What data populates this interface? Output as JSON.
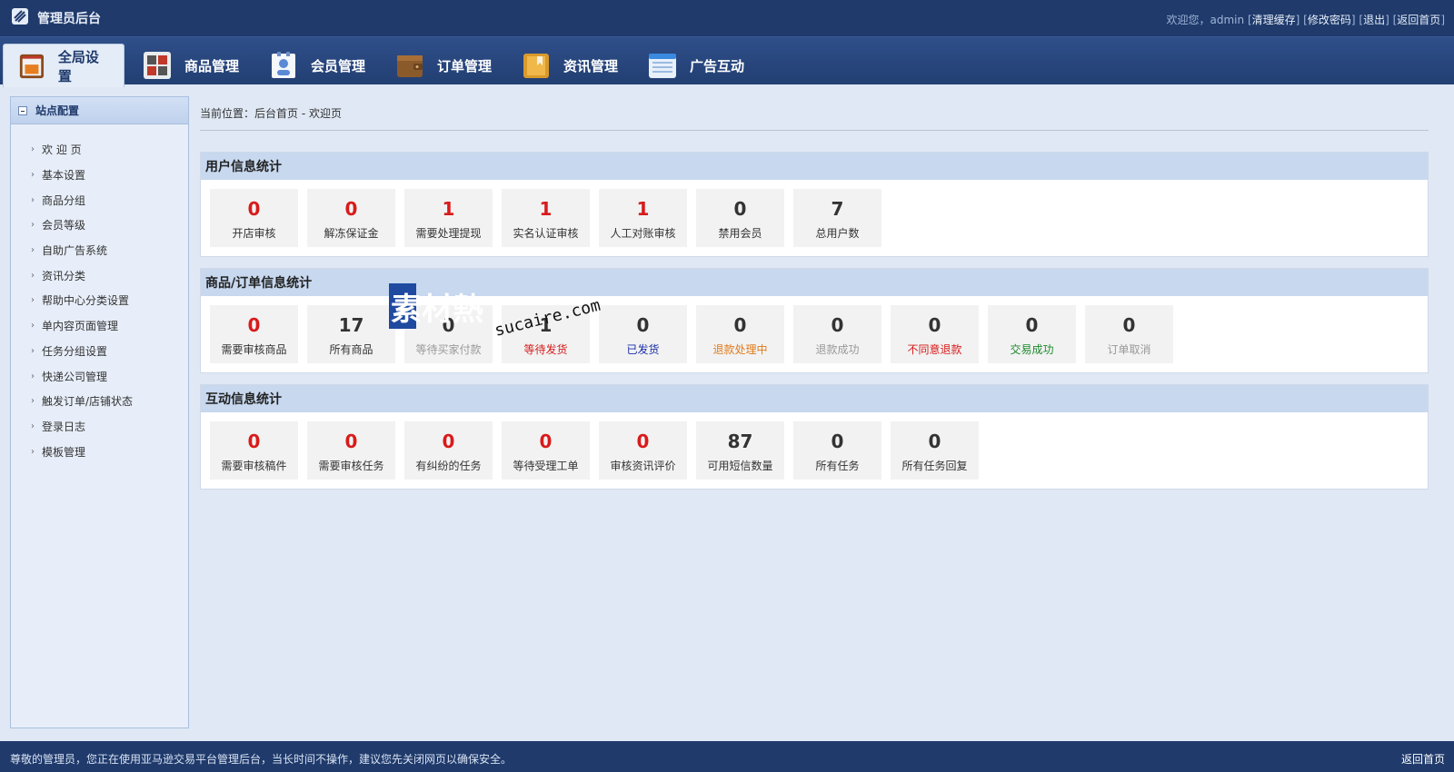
{
  "header": {
    "title": "管理员后台",
    "welcome": "欢迎您，admin",
    "links": [
      "清理缓存",
      "修改密码",
      "退出",
      "返回首页"
    ]
  },
  "nav": {
    "tabs": [
      {
        "label": "全局设置",
        "icon": "home-panel-icon",
        "active": true
      },
      {
        "label": "商品管理",
        "icon": "goods-grid-icon",
        "active": false
      },
      {
        "label": "会员管理",
        "icon": "member-card-icon",
        "active": false
      },
      {
        "label": "订单管理",
        "icon": "wallet-icon",
        "active": false
      },
      {
        "label": "资讯管理",
        "icon": "folder-doc-icon",
        "active": false
      },
      {
        "label": "广告互动",
        "icon": "browser-window-icon",
        "active": false
      }
    ]
  },
  "sidebar": {
    "title": "站点配置",
    "items": [
      "欢 迎 页",
      "基本设置",
      "商品分组",
      "会员等级",
      "自助广告系统",
      "资讯分类",
      "帮助中心分类设置",
      "单内容页面管理",
      "任务分组设置",
      "快递公司管理",
      "触发订单/店铺状态",
      "登录日志",
      "模板管理"
    ]
  },
  "breadcrumb": "当前位置：后台首页 - 欢迎页",
  "panels": [
    {
      "title": "用户信息统计",
      "cards": [
        {
          "value": "0",
          "label": "开店审核",
          "num_color": "#d81b1b",
          "label_color": "#333333"
        },
        {
          "value": "0",
          "label": "解冻保证金",
          "num_color": "#d81b1b",
          "label_color": "#333333"
        },
        {
          "value": "1",
          "label": "需要处理提现",
          "num_color": "#d81b1b",
          "label_color": "#333333"
        },
        {
          "value": "1",
          "label": "实名认证审核",
          "num_color": "#d81b1b",
          "label_color": "#333333"
        },
        {
          "value": "1",
          "label": "人工对账审核",
          "num_color": "#d81b1b",
          "label_color": "#333333"
        },
        {
          "value": "0",
          "label": "禁用会员",
          "num_color": "#333333",
          "label_color": "#333333"
        },
        {
          "value": "7",
          "label": "总用户数",
          "num_color": "#333333",
          "label_color": "#333333"
        }
      ]
    },
    {
      "title": "商品/订单信息统计",
      "cards": [
        {
          "value": "0",
          "label": "需要审核商品",
          "num_color": "#d81b1b",
          "label_color": "#333333"
        },
        {
          "value": "17",
          "label": "所有商品",
          "num_color": "#333333",
          "label_color": "#333333"
        },
        {
          "value": "0",
          "label": "等待买家付款",
          "num_color": "#333333",
          "label_color": "#999999"
        },
        {
          "value": "1",
          "label": "等待发货",
          "num_color": "#333333",
          "label_color": "#d81b1b"
        },
        {
          "value": "0",
          "label": "已发货",
          "num_color": "#333333",
          "label_color": "#1b2fa8"
        },
        {
          "value": "0",
          "label": "退款处理中",
          "num_color": "#333333",
          "label_color": "#e07a1a"
        },
        {
          "value": "0",
          "label": "退款成功",
          "num_color": "#333333",
          "label_color": "#999999"
        },
        {
          "value": "0",
          "label": "不同意退款",
          "num_color": "#333333",
          "label_color": "#d81b1b"
        },
        {
          "value": "0",
          "label": "交易成功",
          "num_color": "#333333",
          "label_color": "#1a8a2a"
        },
        {
          "value": "0",
          "label": "订单取消",
          "num_color": "#333333",
          "label_color": "#999999"
        }
      ]
    },
    {
      "title": "互动信息统计",
      "cards": [
        {
          "value": "0",
          "label": "需要审核稿件",
          "num_color": "#d81b1b",
          "label_color": "#333333"
        },
        {
          "value": "0",
          "label": "需要审核任务",
          "num_color": "#d81b1b",
          "label_color": "#333333"
        },
        {
          "value": "0",
          "label": "有纠纷的任务",
          "num_color": "#d81b1b",
          "label_color": "#333333"
        },
        {
          "value": "0",
          "label": "等待受理工单",
          "num_color": "#d81b1b",
          "label_color": "#333333"
        },
        {
          "value": "0",
          "label": "审核资讯评价",
          "num_color": "#d81b1b",
          "label_color": "#333333"
        },
        {
          "value": "87",
          "label": "可用短信数量",
          "num_color": "#333333",
          "label_color": "#333333"
        },
        {
          "value": "0",
          "label": "所有任务",
          "num_color": "#333333",
          "label_color": "#333333"
        },
        {
          "value": "0",
          "label": "所有任务回复",
          "num_color": "#333333",
          "label_color": "#333333"
        }
      ]
    }
  ],
  "watermark": {
    "brand": "素材熱",
    "domain": "sucaire.com"
  },
  "footer": {
    "message": "尊敬的管理员，您正在使用亚马逊交易平台管理后台，当长时间不操作，建议您先关闭网页以确保安全。",
    "home_link": "返回首页"
  },
  "colors": {
    "header_bg": "#1f3a6b",
    "page_bg": "#dfe8f4",
    "panel_header": "#c7d8ef",
    "alert_red": "#d81b1b"
  }
}
